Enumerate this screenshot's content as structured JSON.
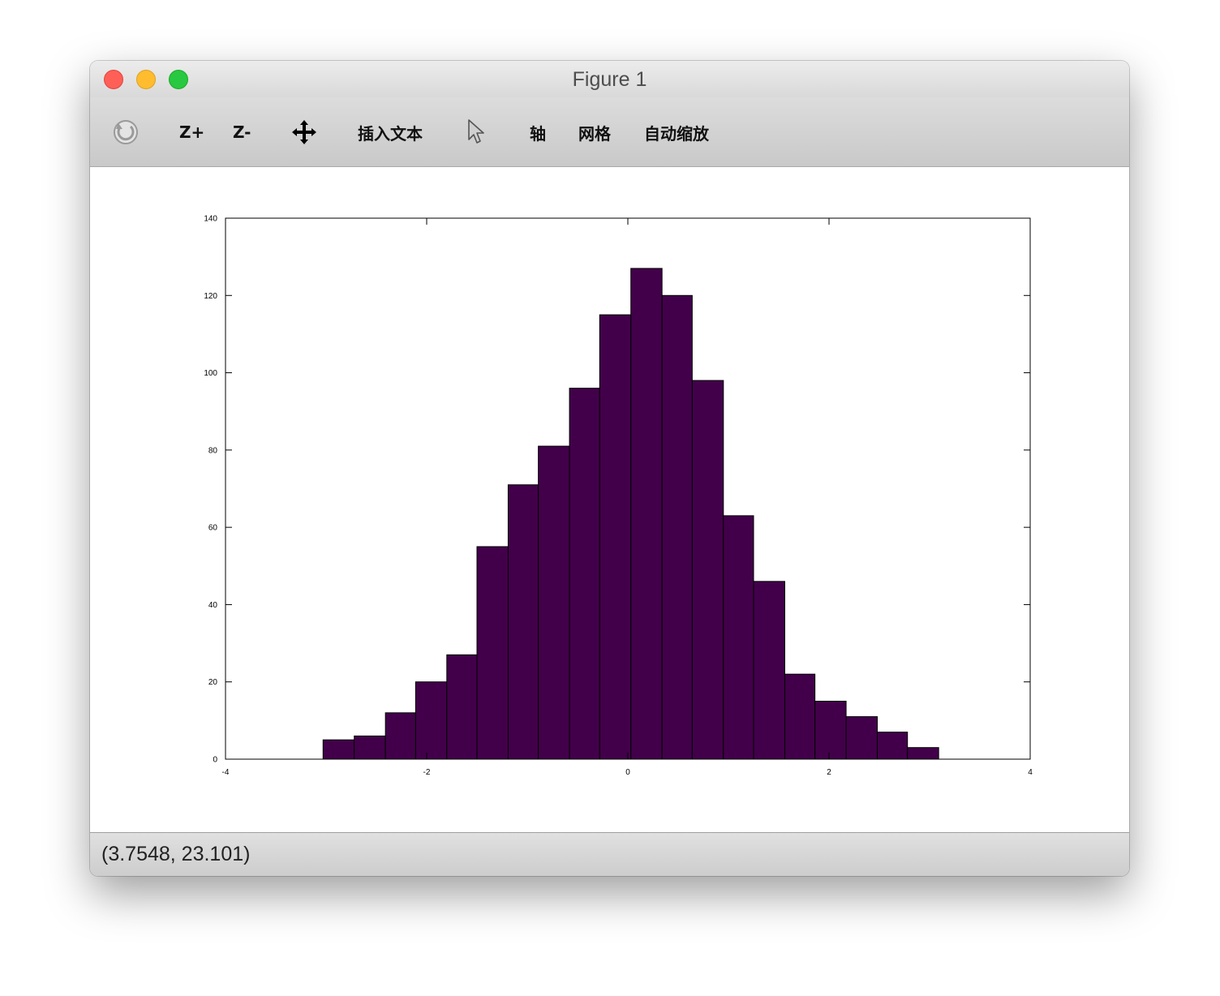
{
  "window": {
    "title": "Figure 1"
  },
  "toolbar": {
    "rotate_icon": "rotate-icon",
    "zoom_in_label": "Z+",
    "zoom_out_label": "Z-",
    "pan_icon": "move-arrows-icon",
    "insert_text_label": "插入文本",
    "select_icon": "pointer-cursor-icon",
    "axis_label": "轴",
    "grid_label": "网格",
    "autoscale_label": "自动缩放"
  },
  "status": {
    "coordinates": "(3.7548, 23.101)"
  },
  "colors": {
    "bar_fill": "#42004a",
    "bar_stroke": "#000000"
  },
  "chart_data": {
    "type": "bar",
    "title": "",
    "xlabel": "",
    "ylabel": "",
    "xlim": [
      -4,
      4
    ],
    "ylim": [
      0,
      140
    ],
    "xticks": [
      -4,
      -2,
      0,
      2,
      4
    ],
    "yticks": [
      0,
      20,
      40,
      60,
      80,
      100,
      120,
      140
    ],
    "grid": false,
    "bins": [
      {
        "x0": -3.03,
        "x1": -2.72,
        "value": 5
      },
      {
        "x0": -2.72,
        "x1": -2.41,
        "value": 6
      },
      {
        "x0": -2.41,
        "x1": -2.11,
        "value": 12
      },
      {
        "x0": -2.11,
        "x1": -1.8,
        "value": 20
      },
      {
        "x0": -1.8,
        "x1": -1.5,
        "value": 27
      },
      {
        "x0": -1.5,
        "x1": -1.19,
        "value": 55
      },
      {
        "x0": -1.19,
        "x1": -0.89,
        "value": 71
      },
      {
        "x0": -0.89,
        "x1": -0.58,
        "value": 81
      },
      {
        "x0": -0.58,
        "x1": -0.28,
        "value": 96
      },
      {
        "x0": -0.28,
        "x1": 0.03,
        "value": 115
      },
      {
        "x0": 0.03,
        "x1": 0.34,
        "value": 127
      },
      {
        "x0": 0.34,
        "x1": 0.64,
        "value": 120
      },
      {
        "x0": 0.64,
        "x1": 0.95,
        "value": 98
      },
      {
        "x0": 0.95,
        "x1": 1.25,
        "value": 63
      },
      {
        "x0": 1.25,
        "x1": 1.56,
        "value": 46
      },
      {
        "x0": 1.56,
        "x1": 1.86,
        "value": 22
      },
      {
        "x0": 1.86,
        "x1": 2.17,
        "value": 15
      },
      {
        "x0": 2.17,
        "x1": 2.48,
        "value": 11
      },
      {
        "x0": 2.48,
        "x1": 2.78,
        "value": 7
      },
      {
        "x0": 2.78,
        "x1": 3.09,
        "value": 3
      }
    ]
  }
}
